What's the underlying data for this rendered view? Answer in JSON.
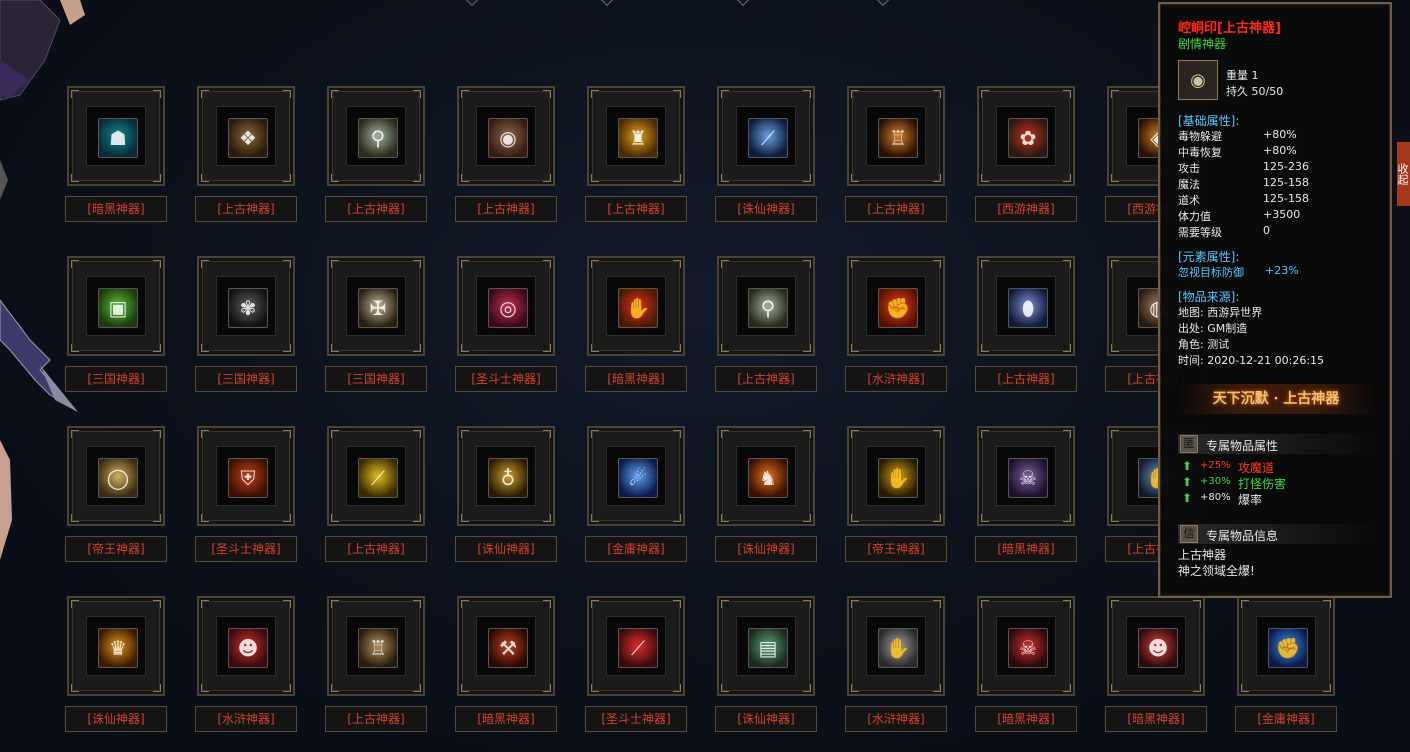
{
  "items": [
    {
      "tag": "[暗黑神器]",
      "icon": "dark-warrior-icon",
      "colors": [
        "#0d8a8a",
        "#0a2a3a"
      ],
      "glyph": "☗"
    },
    {
      "tag": "[上古神器]",
      "icon": "tiger-claw-icon",
      "colors": [
        "#8a6a3a",
        "#2a1a0a"
      ],
      "glyph": "❖"
    },
    {
      "tag": "[上古神器]",
      "icon": "fan-staff-icon",
      "colors": [
        "#a0b0a0",
        "#2a2a1a"
      ],
      "glyph": "⚲"
    },
    {
      "tag": "[上古神器]",
      "icon": "red-ring-icon",
      "colors": [
        "#8a6a4a",
        "#3a1a10"
      ],
      "glyph": "◉"
    },
    {
      "tag": "[上古神器]",
      "icon": "golden-bell-icon",
      "colors": [
        "#e0a020",
        "#4a2a00"
      ],
      "glyph": "♜"
    },
    {
      "tag": "[诛仙神器]",
      "icon": "blue-sword-icon",
      "colors": [
        "#6aa0e0",
        "#0a1a3a"
      ],
      "glyph": "⟋"
    },
    {
      "tag": "[上古神器]",
      "icon": "pagoda-icon",
      "colors": [
        "#d08030",
        "#2a1000"
      ],
      "glyph": "♖"
    },
    {
      "tag": "[西游神器]",
      "icon": "red-amulet-icon",
      "colors": [
        "#c03020",
        "#2a1a10"
      ],
      "glyph": "✿"
    },
    {
      "tag": "[西游神器]",
      "icon": "gold-necklace-icon",
      "colors": [
        "#d08030",
        "#2a1000"
      ],
      "glyph": "◈"
    },
    {
      "tag": "[三国神器]",
      "icon": "jade-seal-icon",
      "colors": [
        "#60c040",
        "#1a3a0a"
      ],
      "glyph": "▣"
    },
    {
      "tag": "[三国神器]",
      "icon": "dark-flower-icon",
      "colors": [
        "#606060",
        "#101010"
      ],
      "glyph": "✾"
    },
    {
      "tag": "[三国神器]",
      "icon": "justice-emblem-icon",
      "colors": [
        "#c0b090",
        "#2a2010"
      ],
      "glyph": "✠"
    },
    {
      "tag": "[圣斗士神器]",
      "icon": "crimson-bracelet-icon",
      "colors": [
        "#c03050",
        "#3a0a1a"
      ],
      "glyph": "◎"
    },
    {
      "tag": "[暗黑神器]",
      "icon": "flame-gauntlet-icon",
      "colors": [
        "#e03020",
        "#4a1a00"
      ],
      "glyph": "✋"
    },
    {
      "tag": "[上古神器]",
      "icon": "fan-staff-icon",
      "colors": [
        "#a0b0a0",
        "#2a2a1a"
      ],
      "glyph": "⚲"
    },
    {
      "tag": "[水浒神器]",
      "icon": "fire-fist-icon",
      "colors": [
        "#e04020",
        "#5a1000"
      ],
      "glyph": "✊"
    },
    {
      "tag": "[上古神器]",
      "icon": "moon-gem-icon",
      "colors": [
        "#8090d0",
        "#101a3a"
      ],
      "glyph": "⬮"
    },
    {
      "tag": "[上古神器]",
      "icon": "bronze-ring-icon",
      "colors": [
        "#a08060",
        "#2a1a10"
      ],
      "glyph": "◍"
    },
    {
      "tag": "[帝王神器]",
      "icon": "gold-ring-icon",
      "colors": [
        "#d0b060",
        "#3a2a10"
      ],
      "glyph": "◯"
    },
    {
      "tag": "[圣斗士神器]",
      "icon": "red-armor-icon",
      "colors": [
        "#c04020",
        "#3a1000"
      ],
      "glyph": "⛨"
    },
    {
      "tag": "[上古神器]",
      "icon": "gold-blade-icon",
      "colors": [
        "#e0c020",
        "#3a2a00"
      ],
      "glyph": "⟋"
    },
    {
      "tag": "[诛仙神器]",
      "icon": "gold-necklace-icon",
      "colors": [
        "#d0a030",
        "#2a1a00"
      ],
      "glyph": "♁"
    },
    {
      "tag": "[金庸神器]",
      "icon": "ice-claw-icon",
      "colors": [
        "#60a0f0",
        "#0a1a4a"
      ],
      "glyph": "☄"
    },
    {
      "tag": "[诛仙神器]",
      "icon": "fire-dragon-icon",
      "colors": [
        "#e07020",
        "#3a1000"
      ],
      "glyph": "♞"
    },
    {
      "tag": "[帝王神器]",
      "icon": "gold-gauntlet-icon",
      "colors": [
        "#d0a020",
        "#2a1a00"
      ],
      "glyph": "✋"
    },
    {
      "tag": "[暗黑神器]",
      "icon": "demon-mask-icon",
      "colors": [
        "#8060a0",
        "#1a102a"
      ],
      "glyph": "☠"
    },
    {
      "tag": "[上古神器]",
      "icon": "blue-gauntlet-icon",
      "colors": [
        "#7090c0",
        "#101a2a"
      ],
      "glyph": "✋"
    },
    {
      "tag": "[诛仙神器]",
      "icon": "golden-helm-icon",
      "colors": [
        "#e09020",
        "#3a1a00"
      ],
      "glyph": "♛"
    },
    {
      "tag": "[水浒神器]",
      "icon": "red-mask-icon",
      "colors": [
        "#d03030",
        "#3a0a0a"
      ],
      "glyph": "☻"
    },
    {
      "tag": "[上古神器]",
      "icon": "pagoda-icon",
      "colors": [
        "#b09060",
        "#2a1a0a"
      ],
      "glyph": "♖"
    },
    {
      "tag": "[暗黑神器]",
      "icon": "chain-whip-icon",
      "colors": [
        "#c04020",
        "#2a0a00"
      ],
      "glyph": "⚒"
    },
    {
      "tag": "[圣斗士神器]",
      "icon": "crimson-blade-icon",
      "colors": [
        "#e03030",
        "#3a0a0a"
      ],
      "glyph": "⟋"
    },
    {
      "tag": "[诛仙神器]",
      "icon": "treasure-chest-icon",
      "colors": [
        "#60a080",
        "#1a2a1a"
      ],
      "glyph": "▤"
    },
    {
      "tag": "[水浒神器]",
      "icon": "steel-gauntlet-icon",
      "colors": [
        "#a0a0a0",
        "#2a2a2a"
      ],
      "glyph": "✋"
    },
    {
      "tag": "[暗黑神器]",
      "icon": "crimson-demon-icon",
      "colors": [
        "#d03030",
        "#2a0a0a"
      ],
      "glyph": "☠"
    },
    {
      "tag": "[暗黑神器]",
      "icon": "red-white-mask-icon",
      "colors": [
        "#e04040",
        "#2a0a0a"
      ],
      "glyph": "☻"
    },
    {
      "tag": "[金庸神器]",
      "icon": "azure-fist-icon",
      "colors": [
        "#4090f0",
        "#0a1a4a"
      ],
      "glyph": "✊"
    }
  ],
  "tooltip": {
    "title": "崆峒印[上古神器]",
    "subtitle": "剧情神器",
    "icon_glyph": "◉",
    "weight": "重量 1",
    "durability": "持久 50/50",
    "base_header": "[基础属性]:",
    "base_attrs": [
      {
        "k": "毒物躲避",
        "v": "+80%"
      },
      {
        "k": "中毒恢复",
        "v": "+80%"
      },
      {
        "k": "攻击",
        "v": "125-236"
      },
      {
        "k": "魔法",
        "v": "125-158"
      },
      {
        "k": "道术",
        "v": "125-158"
      },
      {
        "k": "体力值",
        "v": "+3500"
      },
      {
        "k": "需要等级",
        "v": "0"
      }
    ],
    "element_header": "[元素属性]:",
    "element_key": "忽视目标防御",
    "element_val": "+23%",
    "source_header": "[物品来源]:",
    "source_lines": [
      "地图: 西游异世界",
      "出处: GM制造",
      "角色: 测试",
      "时间: 2020-12-21 00:26:15"
    ],
    "banner": "天下沉默 · 上古神器",
    "exclusive_attr_icon": "匿",
    "exclusive_attr_header": "专属物品属性",
    "exclusive_attrs": [
      {
        "pct": "+25%",
        "name": "攻魔道",
        "pct_color": "#ff3a2a",
        "name_color": "#ff3a2a"
      },
      {
        "pct": "+30%",
        "name": "打怪伤害",
        "pct_color": "#3fd63f",
        "name_color": "#3fd63f"
      },
      {
        "pct": "+80%",
        "name": "爆率",
        "pct_color": "#e8e8e8",
        "name_color": "#e8e8e8"
      }
    ],
    "exclusive_info_icon": "信",
    "exclusive_info_header": "专属物品信息",
    "info_lines": [
      "上古神器",
      "神之领域全爆!"
    ]
  },
  "side_tab": "收起"
}
